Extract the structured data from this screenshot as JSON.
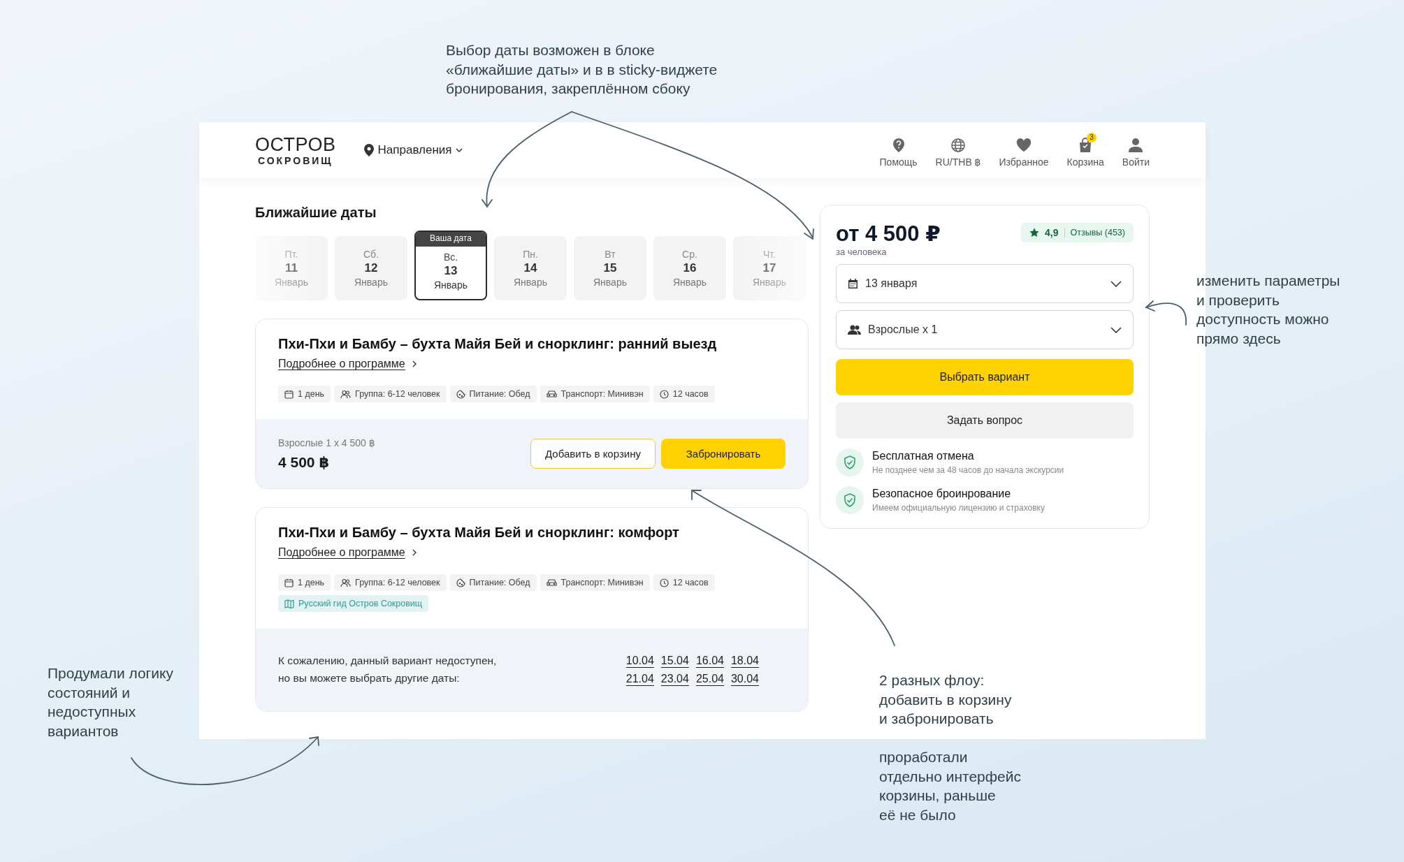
{
  "annotations": [
    {
      "text": "Выбор даты возможен в блоке\n«ближайшие даты» и в в sticky-виджете\nбронирования, закреплённом сбоку"
    },
    {
      "text": "изменить параметры\nи проверить\nдоступность можно\nпрямо здесь"
    },
    {
      "text": "Продумали логику\nсостояний и\nнедоступных\nвариантов"
    },
    {
      "text": "2 разных флоу:\nдобавить в корзину\nи забронировать"
    },
    {
      "text": "проработали\nотдельно интерфейс\nкорзины, раньше\nеё не было"
    }
  ],
  "header": {
    "logo_top": "ОСТРОВ",
    "logo_bottom": "СОКРОВИЩ",
    "nav": "Направления",
    "actions": [
      {
        "label": "Помощь"
      },
      {
        "label": "RU/THB ฿"
      },
      {
        "label": "Избранное"
      },
      {
        "label": "Корзина",
        "badge": "3"
      },
      {
        "label": "Войти"
      }
    ]
  },
  "dates": {
    "title": "Ближайшие даты",
    "tag": "Ваша дата",
    "items": [
      {
        "weekday": "Пт.",
        "day": "11",
        "month": "Январь",
        "selected": false
      },
      {
        "weekday": "Сб.",
        "day": "12",
        "month": "Январь",
        "selected": false
      },
      {
        "weekday": "Вс.",
        "day": "13",
        "month": "Январь",
        "selected": true
      },
      {
        "weekday": "Пн.",
        "day": "14",
        "month": "Январь",
        "selected": false
      },
      {
        "weekday": "Вт",
        "day": "15",
        "month": "Январь",
        "selected": false
      },
      {
        "weekday": "Ср.",
        "day": "16",
        "month": "Январь",
        "selected": false
      },
      {
        "weekday": "Чт.",
        "day": "17",
        "month": "Январь",
        "selected": false
      }
    ]
  },
  "offers": [
    {
      "title": "Пхи-Пхи и Бамбу – бухта Майя Бей и снорклинг: ранний выезд",
      "link": "Подробнее о программе",
      "chips": [
        {
          "kind": "days",
          "text": "1 день"
        },
        {
          "kind": "group",
          "text": "Группа: 6-12 человек"
        },
        {
          "kind": "food",
          "text": "Питание: Обед"
        },
        {
          "kind": "transport",
          "text": "Транспорт: Минивэн"
        },
        {
          "kind": "time",
          "text": "12 часов"
        }
      ],
      "footer": {
        "kind": "price",
        "breakdown": "Взрослые 1 x 4 500 ฿",
        "total": "4 500 ฿",
        "cart_button": "Добавить в корзину",
        "book_button": "Забронировать"
      }
    },
    {
      "title": "Пхи-Пхи и Бамбу – бухта Майя Бей и снорклинг: комфорт",
      "link": "Подробнее о программе",
      "chips": [
        {
          "kind": "days",
          "text": "1 день"
        },
        {
          "kind": "group",
          "text": "Группа: 6-12 человек"
        },
        {
          "kind": "food",
          "text": "Питание: Обед"
        },
        {
          "kind": "transport",
          "text": "Транспорт: Минивэн"
        },
        {
          "kind": "time",
          "text": "12 часов"
        },
        {
          "kind": "guide",
          "text": "Русский гид Остров Сокровищ"
        }
      ],
      "footer": {
        "kind": "unavailable",
        "message": "К сожалению, данный вариант недоступен,\nно вы можете выбрать другие даты:",
        "dates": [
          "10.04",
          "15.04",
          "16.04",
          "18.04",
          "21.04",
          "23.04",
          "25.04",
          "30.04"
        ]
      }
    }
  ],
  "widget": {
    "price": "от 4 500 ₽",
    "price_note": "за человека",
    "rating": "4,9",
    "reviews": "Отзывы (453)",
    "date_value": "13 января",
    "guests_value": "Взрослые x 1",
    "primary_button": "Выбрать вариант",
    "secondary_button": "Задать вопрос",
    "guarantees": [
      {
        "title": "Бесплатная отмена",
        "text": "Не позднее чем за 48 часов до начала экскурсии"
      },
      {
        "title": "Безопасное броинрование",
        "text": "Имеем официальную лицензию и страховку"
      }
    ]
  }
}
